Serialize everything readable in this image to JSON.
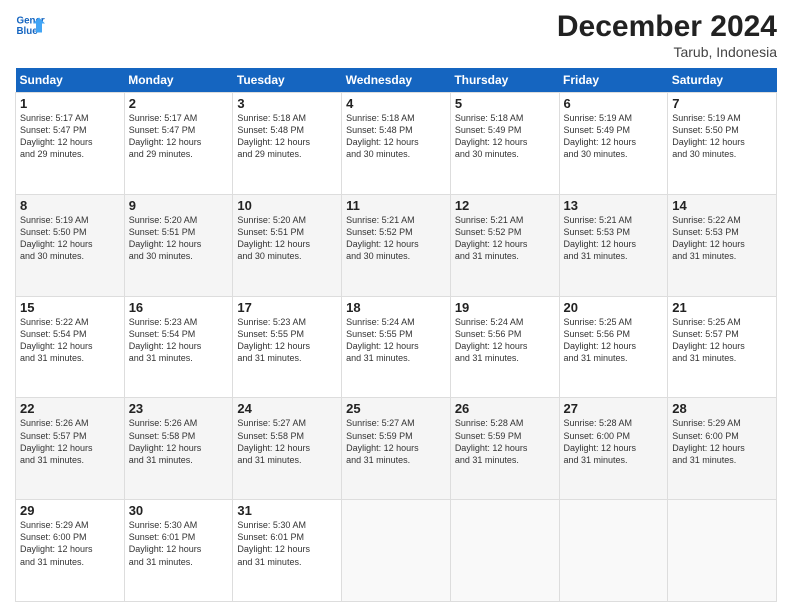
{
  "header": {
    "logo_line1": "General",
    "logo_line2": "Blue",
    "month_title": "December 2024",
    "location": "Tarub, Indonesia"
  },
  "weekdays": [
    "Sunday",
    "Monday",
    "Tuesday",
    "Wednesday",
    "Thursday",
    "Friday",
    "Saturday"
  ],
  "weeks": [
    [
      {
        "day": "1",
        "info": "Sunrise: 5:17 AM\nSunset: 5:47 PM\nDaylight: 12 hours\nand 29 minutes."
      },
      {
        "day": "2",
        "info": "Sunrise: 5:17 AM\nSunset: 5:47 PM\nDaylight: 12 hours\nand 29 minutes."
      },
      {
        "day": "3",
        "info": "Sunrise: 5:18 AM\nSunset: 5:48 PM\nDaylight: 12 hours\nand 29 minutes."
      },
      {
        "day": "4",
        "info": "Sunrise: 5:18 AM\nSunset: 5:48 PM\nDaylight: 12 hours\nand 30 minutes."
      },
      {
        "day": "5",
        "info": "Sunrise: 5:18 AM\nSunset: 5:49 PM\nDaylight: 12 hours\nand 30 minutes."
      },
      {
        "day": "6",
        "info": "Sunrise: 5:19 AM\nSunset: 5:49 PM\nDaylight: 12 hours\nand 30 minutes."
      },
      {
        "day": "7",
        "info": "Sunrise: 5:19 AM\nSunset: 5:50 PM\nDaylight: 12 hours\nand 30 minutes."
      }
    ],
    [
      {
        "day": "8",
        "info": "Sunrise: 5:19 AM\nSunset: 5:50 PM\nDaylight: 12 hours\nand 30 minutes."
      },
      {
        "day": "9",
        "info": "Sunrise: 5:20 AM\nSunset: 5:51 PM\nDaylight: 12 hours\nand 30 minutes."
      },
      {
        "day": "10",
        "info": "Sunrise: 5:20 AM\nSunset: 5:51 PM\nDaylight: 12 hours\nand 30 minutes."
      },
      {
        "day": "11",
        "info": "Sunrise: 5:21 AM\nSunset: 5:52 PM\nDaylight: 12 hours\nand 30 minutes."
      },
      {
        "day": "12",
        "info": "Sunrise: 5:21 AM\nSunset: 5:52 PM\nDaylight: 12 hours\nand 31 minutes."
      },
      {
        "day": "13",
        "info": "Sunrise: 5:21 AM\nSunset: 5:53 PM\nDaylight: 12 hours\nand 31 minutes."
      },
      {
        "day": "14",
        "info": "Sunrise: 5:22 AM\nSunset: 5:53 PM\nDaylight: 12 hours\nand 31 minutes."
      }
    ],
    [
      {
        "day": "15",
        "info": "Sunrise: 5:22 AM\nSunset: 5:54 PM\nDaylight: 12 hours\nand 31 minutes."
      },
      {
        "day": "16",
        "info": "Sunrise: 5:23 AM\nSunset: 5:54 PM\nDaylight: 12 hours\nand 31 minutes."
      },
      {
        "day": "17",
        "info": "Sunrise: 5:23 AM\nSunset: 5:55 PM\nDaylight: 12 hours\nand 31 minutes."
      },
      {
        "day": "18",
        "info": "Sunrise: 5:24 AM\nSunset: 5:55 PM\nDaylight: 12 hours\nand 31 minutes."
      },
      {
        "day": "19",
        "info": "Sunrise: 5:24 AM\nSunset: 5:56 PM\nDaylight: 12 hours\nand 31 minutes."
      },
      {
        "day": "20",
        "info": "Sunrise: 5:25 AM\nSunset: 5:56 PM\nDaylight: 12 hours\nand 31 minutes."
      },
      {
        "day": "21",
        "info": "Sunrise: 5:25 AM\nSunset: 5:57 PM\nDaylight: 12 hours\nand 31 minutes."
      }
    ],
    [
      {
        "day": "22",
        "info": "Sunrise: 5:26 AM\nSunset: 5:57 PM\nDaylight: 12 hours\nand 31 minutes."
      },
      {
        "day": "23",
        "info": "Sunrise: 5:26 AM\nSunset: 5:58 PM\nDaylight: 12 hours\nand 31 minutes."
      },
      {
        "day": "24",
        "info": "Sunrise: 5:27 AM\nSunset: 5:58 PM\nDaylight: 12 hours\nand 31 minutes."
      },
      {
        "day": "25",
        "info": "Sunrise: 5:27 AM\nSunset: 5:59 PM\nDaylight: 12 hours\nand 31 minutes."
      },
      {
        "day": "26",
        "info": "Sunrise: 5:28 AM\nSunset: 5:59 PM\nDaylight: 12 hours\nand 31 minutes."
      },
      {
        "day": "27",
        "info": "Sunrise: 5:28 AM\nSunset: 6:00 PM\nDaylight: 12 hours\nand 31 minutes."
      },
      {
        "day": "28",
        "info": "Sunrise: 5:29 AM\nSunset: 6:00 PM\nDaylight: 12 hours\nand 31 minutes."
      }
    ],
    [
      {
        "day": "29",
        "info": "Sunrise: 5:29 AM\nSunset: 6:00 PM\nDaylight: 12 hours\nand 31 minutes."
      },
      {
        "day": "30",
        "info": "Sunrise: 5:30 AM\nSunset: 6:01 PM\nDaylight: 12 hours\nand 31 minutes."
      },
      {
        "day": "31",
        "info": "Sunrise: 5:30 AM\nSunset: 6:01 PM\nDaylight: 12 hours\nand 31 minutes."
      },
      {
        "day": "",
        "info": ""
      },
      {
        "day": "",
        "info": ""
      },
      {
        "day": "",
        "info": ""
      },
      {
        "day": "",
        "info": ""
      }
    ]
  ]
}
